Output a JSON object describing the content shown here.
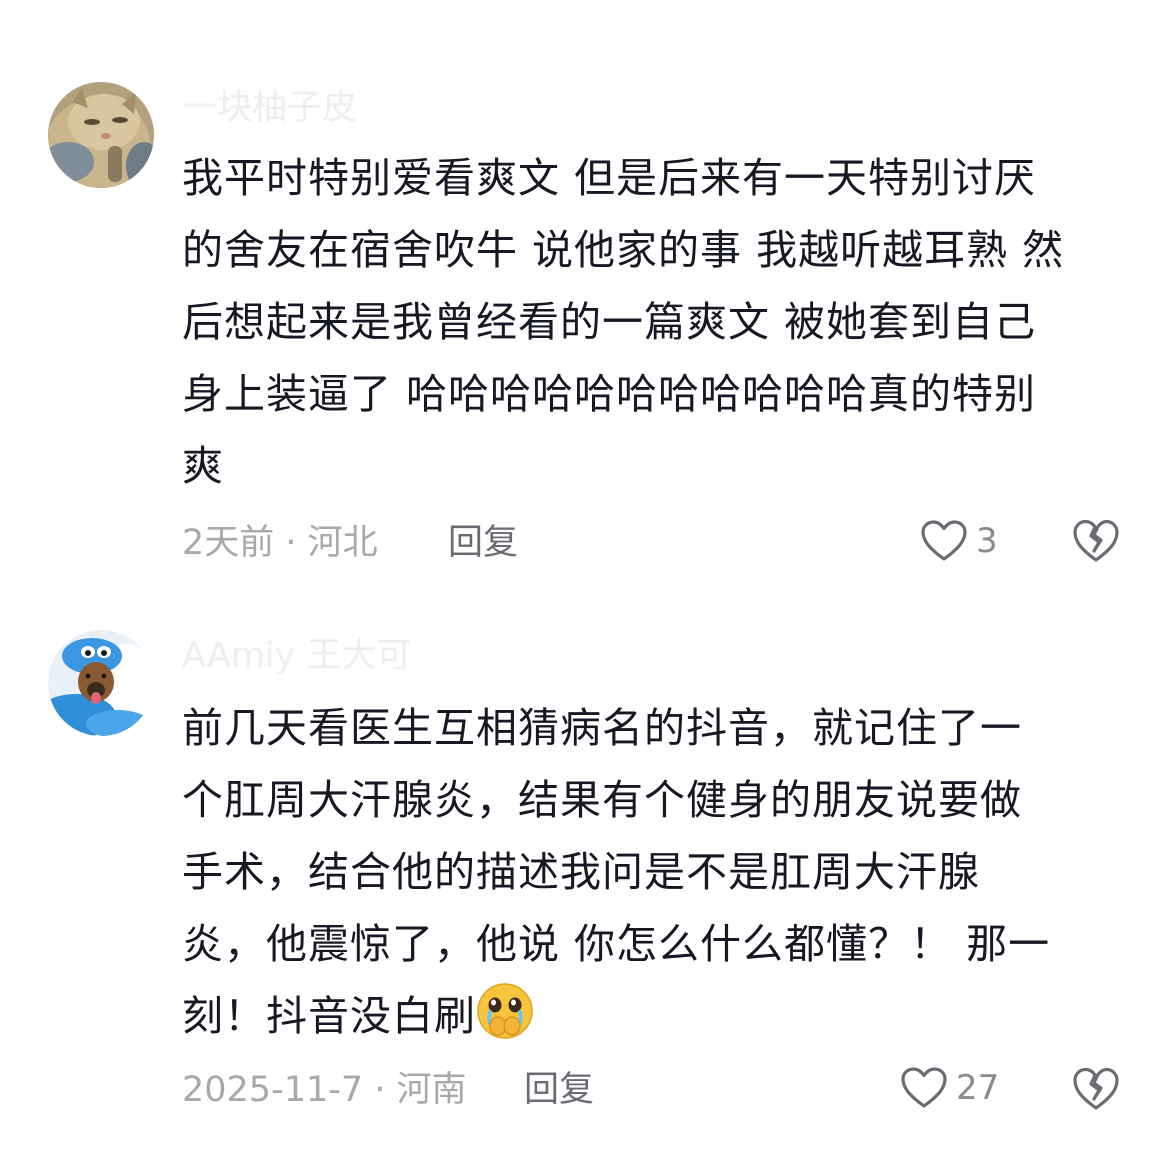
{
  "comments": [
    {
      "username": "一块柚子皮",
      "avatar_icon": "cat-avatar-icon",
      "lines": [
        "我平时特别爱看爽文 但是后来有一天特别讨厌",
        "的舍友在宿舍吹牛 说他家的事 我越听越耳熟 然",
        "后想起来是我曾经看的一篇爽文 被她套到自己",
        "身上装逼了 哈哈哈哈哈哈哈哈哈哈哈真的特别",
        "爽"
      ],
      "time_location": "2天前 · 河北",
      "reply_label": "回复",
      "likes": "3"
    },
    {
      "username": "AAmiy 王大可",
      "avatar_icon": "dog-avatar-icon",
      "lines": [
        "前几天看医生互相猜病名的抖音，就记住了一",
        "个肛周大汗腺炎，结果有个健身的朋友说要做",
        "手术，结合他的描述我问是不是肛周大汗腺",
        "炎，他震惊了，他说 你怎么什么都懂？！ 那一",
        "刻！抖音没白刷"
      ],
      "emoji": "tearful-face-emoji",
      "time_location": "2025-11-7 · 河南",
      "reply_label": "回复",
      "likes": "27"
    }
  ],
  "colors": {
    "text": "#161823",
    "meta": "#a8a8ad",
    "reply": "#6b6c73",
    "icon": "#6b6c73"
  }
}
